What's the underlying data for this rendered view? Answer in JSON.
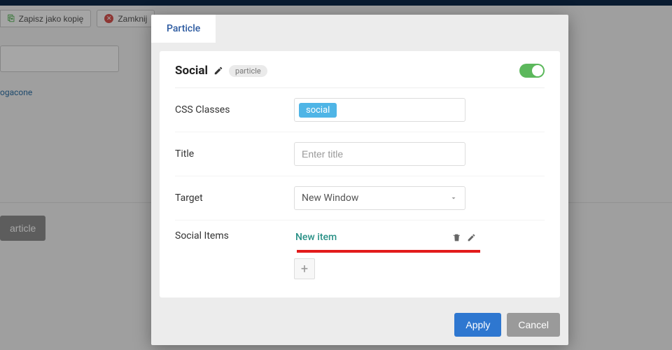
{
  "background": {
    "save_copy_label": "Zapisz jako kopię",
    "close_label": "Zamknij",
    "enriched_link": "ogacone",
    "particle_button": "article"
  },
  "modal": {
    "tab_label": "Particle",
    "header": {
      "title": "Social",
      "chip": "particle",
      "enabled": true
    },
    "fields": {
      "css_classes": {
        "label": "CSS Classes",
        "tags": [
          "social"
        ]
      },
      "title": {
        "label": "Title",
        "placeholder": "Enter title",
        "value": ""
      },
      "target": {
        "label": "Target",
        "value": "New Window"
      },
      "social_items": {
        "label": "Social Items",
        "items": [
          {
            "name": "New item"
          }
        ]
      }
    },
    "footer": {
      "apply": "Apply",
      "cancel": "Cancel"
    }
  }
}
